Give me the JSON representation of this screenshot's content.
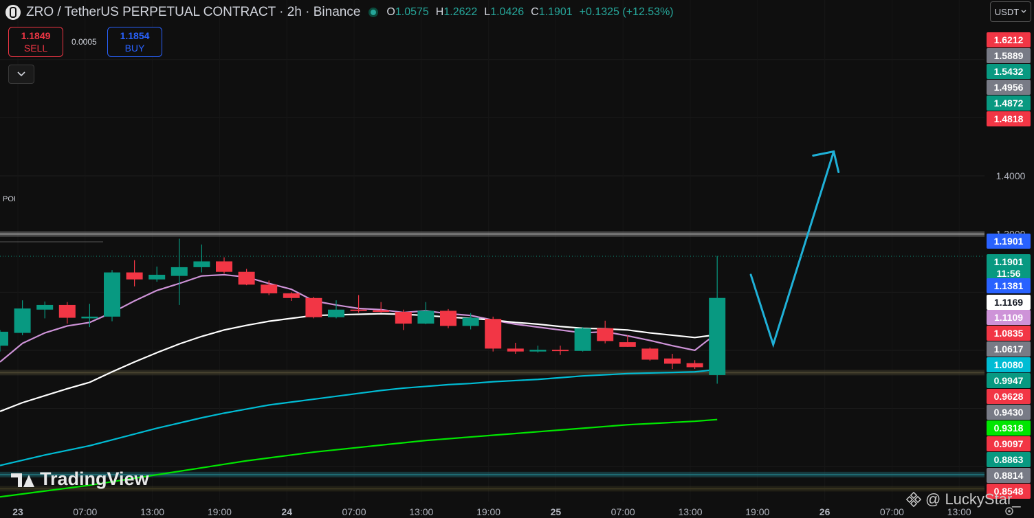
{
  "header": {
    "title": "ZRO / TetherUS PERPETUAL CONTRACT · 2h · Binance",
    "ohlc": [
      {
        "label": "O",
        "value": "1.0575"
      },
      {
        "label": "H",
        "value": "1.2622"
      },
      {
        "label": "L",
        "value": "1.0426"
      },
      {
        "label": "C",
        "value": "1.1901"
      }
    ],
    "change": "+0.1325 (+12.53%)"
  },
  "trade": {
    "sell_price": "1.1849",
    "sell_label": "SELL",
    "spread": "0.0005",
    "buy_price": "1.1854",
    "buy_label": "BUY"
  },
  "currency": "USDT",
  "poi_label": "POI",
  "branding": {
    "logo_text": "TradingView",
    "watermark": "@ LuckyStar_"
  },
  "colors": {
    "up": "#089981",
    "down": "#f23645",
    "background": "#0f0f0f"
  },
  "chart_data": {
    "type": "candlestick",
    "ylim": [
      0.84,
      1.66
    ],
    "x_ticks": [
      "23",
      "07:00",
      "13:00",
      "19:00",
      "24",
      "07:00",
      "13:00",
      "19:00",
      "25",
      "07:00",
      "13:00",
      "19:00",
      "26",
      "07:00",
      "13:00"
    ],
    "y_ticks": [
      "1.4000",
      "1.3000"
    ],
    "price_labels": [
      {
        "value": "1.6212",
        "color": "#f23645"
      },
      {
        "value": "1.5889",
        "color": "#787b86"
      },
      {
        "value": "1.5432",
        "color": "#089981"
      },
      {
        "value": "1.4956",
        "color": "#787b86"
      },
      {
        "value": "1.4872",
        "color": "#089981"
      },
      {
        "value": "1.4818",
        "color": "#f23645"
      },
      {
        "value": "1.1901",
        "color": "#2962ff"
      },
      {
        "value": "1.1901",
        "extra": "11:56",
        "color": "#089981"
      },
      {
        "value": "1.1381",
        "color": "#2962ff"
      },
      {
        "value": "1.1169",
        "color": "#ffffff"
      },
      {
        "value": "1.1109",
        "color": "#ce93d8"
      },
      {
        "value": "1.0835",
        "color": "#f23645"
      },
      {
        "value": "1.0617",
        "color": "#787b86"
      },
      {
        "value": "1.0080",
        "color": "#00bcd4"
      },
      {
        "value": "0.9947",
        "color": "#089981"
      },
      {
        "value": "0.9628",
        "color": "#f23645"
      },
      {
        "value": "0.9430",
        "color": "#787b86"
      },
      {
        "value": "0.9318",
        "color": "#00e600"
      },
      {
        "value": "0.9097",
        "color": "#f23645"
      },
      {
        "value": "0.8863",
        "color": "#089981"
      },
      {
        "value": "0.8814",
        "color": "#787b86"
      },
      {
        "value": "0.8548",
        "color": "#f23645"
      }
    ],
    "candles": [
      {
        "o": 1.108,
        "h": 1.135,
        "l": 1.098,
        "c": 1.132
      },
      {
        "o": 1.13,
        "h": 1.186,
        "l": 1.126,
        "c": 1.172
      },
      {
        "o": 1.17,
        "h": 1.184,
        "l": 1.155,
        "c": 1.178
      },
      {
        "o": 1.178,
        "h": 1.183,
        "l": 1.146,
        "c": 1.156
      },
      {
        "o": 1.155,
        "h": 1.18,
        "l": 1.14,
        "c": 1.158
      },
      {
        "o": 1.158,
        "h": 1.238,
        "l": 1.15,
        "c": 1.234
      },
      {
        "o": 1.234,
        "h": 1.255,
        "l": 1.21,
        "c": 1.222
      },
      {
        "o": 1.222,
        "h": 1.244,
        "l": 1.218,
        "c": 1.23
      },
      {
        "o": 1.228,
        "h": 1.292,
        "l": 1.178,
        "c": 1.243
      },
      {
        "o": 1.243,
        "h": 1.282,
        "l": 1.234,
        "c": 1.253
      },
      {
        "o": 1.253,
        "h": 1.26,
        "l": 1.232,
        "c": 1.235
      },
      {
        "o": 1.235,
        "h": 1.24,
        "l": 1.212,
        "c": 1.213
      },
      {
        "o": 1.213,
        "h": 1.22,
        "l": 1.195,
        "c": 1.198
      },
      {
        "o": 1.198,
        "h": 1.2,
        "l": 1.185,
        "c": 1.19
      },
      {
        "o": 1.19,
        "h": 1.192,
        "l": 1.155,
        "c": 1.157
      },
      {
        "o": 1.157,
        "h": 1.186,
        "l": 1.155,
        "c": 1.17
      },
      {
        "o": 1.17,
        "h": 1.195,
        "l": 1.165,
        "c": 1.169
      },
      {
        "o": 1.169,
        "h": 1.183,
        "l": 1.165,
        "c": 1.166
      },
      {
        "o": 1.166,
        "h": 1.17,
        "l": 1.135,
        "c": 1.146
      },
      {
        "o": 1.146,
        "h": 1.183,
        "l": 1.145,
        "c": 1.168
      },
      {
        "o": 1.168,
        "h": 1.171,
        "l": 1.138,
        "c": 1.142
      },
      {
        "o": 1.142,
        "h": 1.164,
        "l": 1.136,
        "c": 1.156
      },
      {
        "o": 1.154,
        "h": 1.158,
        "l": 1.098,
        "c": 1.103
      },
      {
        "o": 1.103,
        "h": 1.113,
        "l": 1.094,
        "c": 1.098
      },
      {
        "o": 1.098,
        "h": 1.108,
        "l": 1.096,
        "c": 1.101
      },
      {
        "o": 1.101,
        "h": 1.108,
        "l": 1.092,
        "c": 1.099
      },
      {
        "o": 1.099,
        "h": 1.14,
        "l": 1.098,
        "c": 1.138
      },
      {
        "o": 1.138,
        "h": 1.151,
        "l": 1.112,
        "c": 1.116
      },
      {
        "o": 1.114,
        "h": 1.126,
        "l": 1.106,
        "c": 1.106
      },
      {
        "o": 1.103,
        "h": 1.105,
        "l": 1.082,
        "c": 1.084
      },
      {
        "o": 1.086,
        "h": 1.094,
        "l": 1.068,
        "c": 1.077
      },
      {
        "o": 1.078,
        "h": 1.083,
        "l": 1.068,
        "c": 1.071
      },
      {
        "o": 1.0575,
        "h": 1.2622,
        "l": 1.0426,
        "c": 1.1901
      }
    ],
    "moving_averages": [
      {
        "color": "#ce93d8",
        "values": [
          1.08,
          1.112,
          1.13,
          1.142,
          1.148,
          1.165,
          1.185,
          1.203,
          1.215,
          1.228,
          1.23,
          1.226,
          1.215,
          1.205,
          1.185,
          1.178,
          1.172,
          1.17,
          1.165,
          1.168,
          1.163,
          1.16,
          1.152,
          1.145,
          1.14,
          1.135,
          1.13,
          1.132,
          1.125,
          1.117,
          1.108,
          1.1,
          1.13
        ]
      },
      {
        "color": "#ffffff",
        "values": [
          0.995,
          1.01,
          1.022,
          1.034,
          1.045,
          1.063,
          1.08,
          1.096,
          1.111,
          1.124,
          1.135,
          1.143,
          1.15,
          1.155,
          1.16,
          1.161,
          1.162,
          1.163,
          1.162,
          1.16,
          1.157,
          1.155,
          1.152,
          1.148,
          1.145,
          1.141,
          1.138,
          1.137,
          1.135,
          1.13,
          1.126,
          1.122,
          1.127
        ]
      },
      {
        "color": "#00bcd4",
        "values": [
          0.902,
          0.911,
          0.92,
          0.928,
          0.936,
          0.946,
          0.956,
          0.966,
          0.975,
          0.984,
          0.992,
          0.999,
          1.006,
          1.011,
          1.016,
          1.021,
          1.026,
          1.031,
          1.035,
          1.038,
          1.041,
          1.043,
          1.046,
          1.048,
          1.05,
          1.053,
          1.056,
          1.058,
          1.06,
          1.061,
          1.062,
          1.063,
          1.067
        ]
      },
      {
        "color": "#00e600",
        "values": [
          0.848,
          0.853,
          0.858,
          0.863,
          0.868,
          0.874,
          0.88,
          0.886,
          0.892,
          0.898,
          0.904,
          0.91,
          0.915,
          0.92,
          0.925,
          0.929,
          0.933,
          0.937,
          0.941,
          0.945,
          0.948,
          0.951,
          0.954,
          0.957,
          0.96,
          0.963,
          0.966,
          0.969,
          0.972,
          0.974,
          0.976,
          0.978,
          0.981
        ]
      }
    ],
    "horizontal_levels": [
      {
        "value": 1.3,
        "color": "#8a8a8a",
        "name": "POI"
      },
      {
        "value": 1.0617,
        "color": "#4a4430"
      },
      {
        "value": 0.8863,
        "color": "#1e6b73"
      },
      {
        "value": 0.862,
        "color": "#3a3620"
      }
    ],
    "projection": {
      "color": "#1fb1d8",
      "points": [
        [
          33.5,
          1.23
        ],
        [
          34.5,
          1.11
        ],
        [
          37.2,
          1.442
        ]
      ]
    }
  }
}
